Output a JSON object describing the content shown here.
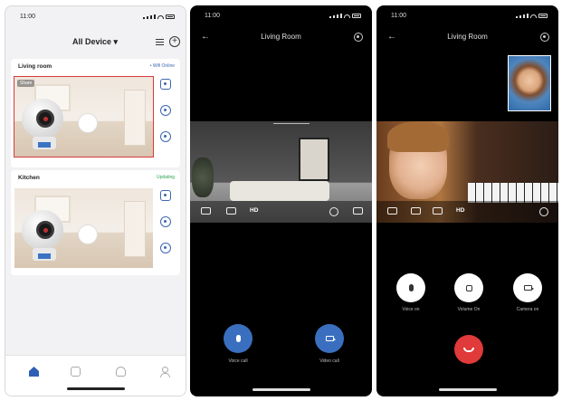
{
  "status_bar": {
    "time": "11:00"
  },
  "phone1": {
    "header": {
      "title": "All Device ▾"
    },
    "devices": [
      {
        "name": "Living room",
        "status": "• Wifi Online",
        "status_color": "#3e67b0",
        "badge": "Share"
      },
      {
        "name": "Kitchen",
        "status": "Updating",
        "status_color": "#2da44e"
      }
    ]
  },
  "phone2": {
    "title": "Living Room",
    "hd_label": "HD",
    "buttons": {
      "voice_call": "Voice call",
      "video_call": "Video call"
    }
  },
  "phone3": {
    "title": "Living Room",
    "hd_label": "HD",
    "buttons": {
      "voice_on": "Voice on",
      "volume_on": "Volume On",
      "camera_on": "Camera on"
    }
  },
  "colors": {
    "accent": "#3a6fbf",
    "hangup": "#e03a3a",
    "selection": "#d93a3a"
  }
}
